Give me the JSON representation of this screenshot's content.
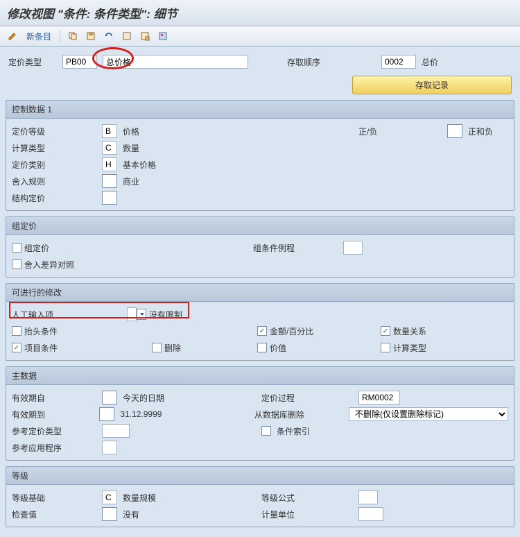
{
  "title": "修改视图 \"条件: 条件类型\": 细节",
  "toolbar": {
    "new_entry": "新条目"
  },
  "header": {
    "pricing_type_label": "定价类型",
    "pricing_type_value": "PB00",
    "pricing_type_desc": "总价格",
    "access_seq_label": "存取顺序",
    "access_seq_value": "0002",
    "access_seq_desc": "总价",
    "access_records_btn": "存取记录"
  },
  "panel1": {
    "title": "控制数据 1",
    "rows": {
      "pricing_level_label": "定价等级",
      "pricing_level_value": "B",
      "pricing_level_desc": "价格",
      "pos_neg_label": "正/负",
      "pos_neg_desc": "正和负",
      "calc_type_label": "计算类型",
      "calc_type_value": "C",
      "calc_type_desc": "数量",
      "pricing_cat_label": "定价类别",
      "pricing_cat_value": "H",
      "pricing_cat_desc": "基本价格",
      "rounding_label": "舍入规则",
      "rounding_desc": "商业",
      "struct_label": "结构定价"
    }
  },
  "panel2": {
    "title": "组定价",
    "group_pricing_label": "组定价",
    "group_cond_routine_label": "组条件例程",
    "rounding_diff_label": "舍入差异对照"
  },
  "panel3": {
    "title": "可进行的修改",
    "manual_entry_label": "人工输入项",
    "manual_entry_value": "",
    "manual_entry_desc": "没有限制",
    "header_cond_label": "抬头条件",
    "amount_pct_label": "金额/百分比",
    "qty_rel_label": "数量关系",
    "item_cond_label": "项目条件",
    "delete_label": "删除",
    "value_label": "价值",
    "calc_type_label": "计算类型"
  },
  "panel4": {
    "title": "主数据",
    "valid_from_label": "有效期自",
    "valid_from_desc": "今天的日期",
    "pricing_proc_label": "定价过程",
    "pricing_proc_value": "RM0002",
    "valid_to_label": "有效期到",
    "valid_to_desc": "31.12.9999",
    "delete_db_label": "从数据库删除",
    "delete_db_value": "不删除(仅设置删除标记)",
    "ref_cond_type_label": "参考定价类型",
    "cond_index_label": "条件索引",
    "ref_app_label": "参考应用程序"
  },
  "panel5": {
    "title": "等级",
    "scale_basis_label": "等级基础",
    "scale_basis_value": "C",
    "scale_basis_desc": "数量规模",
    "scale_formula_label": "等级公式",
    "check_value_label": "检查值",
    "check_value_desc": "没有",
    "uom_label": "计量单位"
  }
}
